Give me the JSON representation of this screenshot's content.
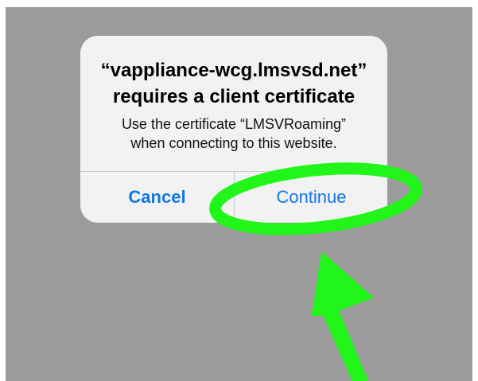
{
  "dialog": {
    "title_line_1": "“vappliance-wcg.lmsvsd.net”",
    "title_line_2": "requires a client certificate",
    "message_line_1": "Use the certificate “LMSVRoaming”",
    "message_line_2": "when connecting to this website.",
    "cancel_label": "Cancel",
    "continue_label": "Continue"
  },
  "colors": {
    "background": "#9b9b9b",
    "alert_background": "#f2f2f2",
    "button_text": "#1177e6",
    "annotation": "#22f51a"
  },
  "annotation": {
    "circle": "green-ellipse",
    "arrow": "green-arrow"
  }
}
